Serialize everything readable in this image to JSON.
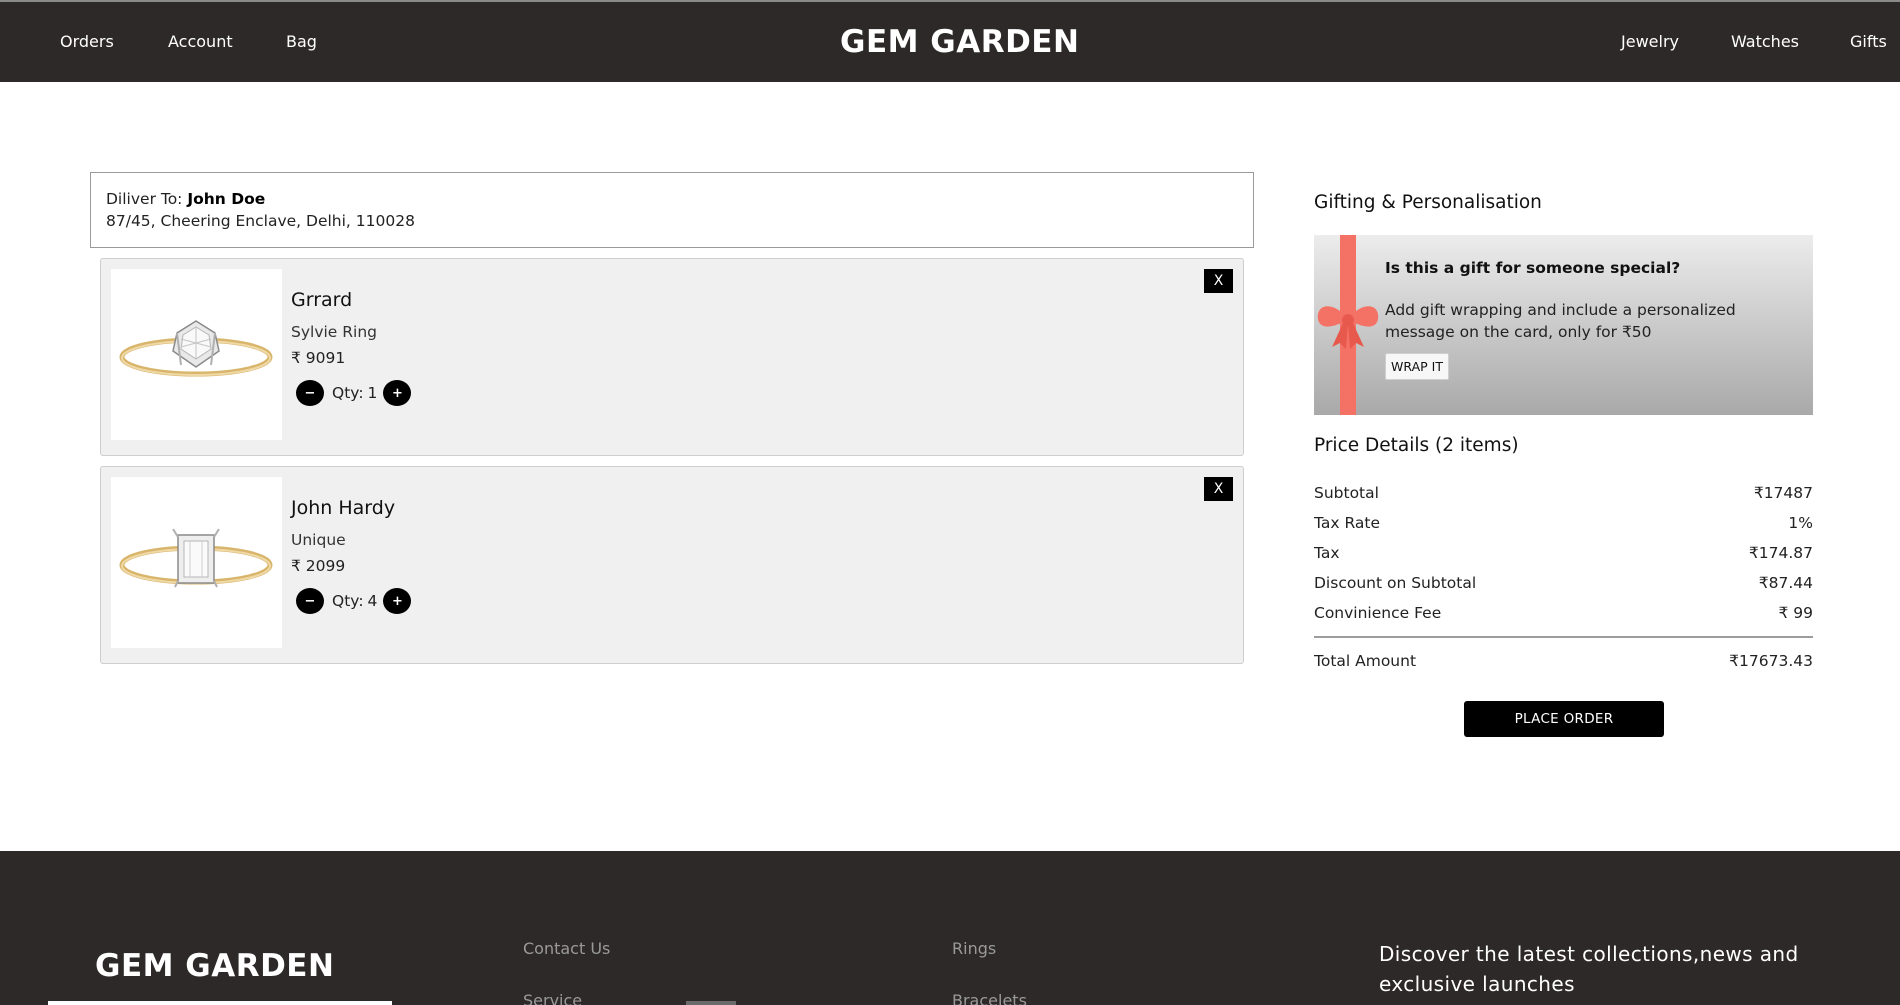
{
  "header": {
    "brand": "GEM GARDEN",
    "left_nav": [
      "Orders",
      "Account",
      "Bag"
    ],
    "right_nav": [
      "Jewelry",
      "Watches",
      "Gifts"
    ]
  },
  "delivery": {
    "label": "Diliver To:",
    "name": "John Doe",
    "address": "87/45, Cheering Enclave, Delhi, 110028"
  },
  "cart": {
    "items": [
      {
        "brand": "Grrard",
        "name": "Sylvie Ring",
        "price": "₹ 9091",
        "qty_label": "Qty:",
        "qty": "1",
        "minus": "−",
        "plus": "+",
        "remove": "X"
      },
      {
        "brand": "John Hardy",
        "name": "Unique",
        "price": "₹ 2099",
        "qty_label": "Qty:",
        "qty": "4",
        "minus": "−",
        "plus": "+",
        "remove": "X"
      }
    ]
  },
  "gifting": {
    "title": "Gifting & Personalisation",
    "heading": "Is this a gift for someone special?",
    "text": "Add gift wrapping and include a personalized message on the card, only for ₹50",
    "button": "WRAP IT",
    "ribbon_color": "#f47265"
  },
  "price_details": {
    "title": "Price Details (2 items)",
    "rows": [
      {
        "label": "Subtotal",
        "value": "₹17487"
      },
      {
        "label": "Tax Rate",
        "value": "1%"
      },
      {
        "label": "Tax",
        "value": "₹174.87"
      },
      {
        "label": "Discount on Subtotal",
        "value": "₹87.44"
      },
      {
        "label": "Convinience Fee",
        "value": "₹ 99"
      }
    ],
    "total_label": "Total Amount",
    "total_value": "₹17673.43",
    "place_order": "PLACE ORDER"
  },
  "footer": {
    "brand": "GEM GARDEN",
    "col1": [
      "Contact Us",
      "Service"
    ],
    "col2": [
      "Rings",
      "Bracelets"
    ],
    "newsletter": "Discover the latest collections,news and exclusive launches"
  },
  "colors": {
    "header_bg": "#2d2929",
    "accent_button": "#000000"
  }
}
